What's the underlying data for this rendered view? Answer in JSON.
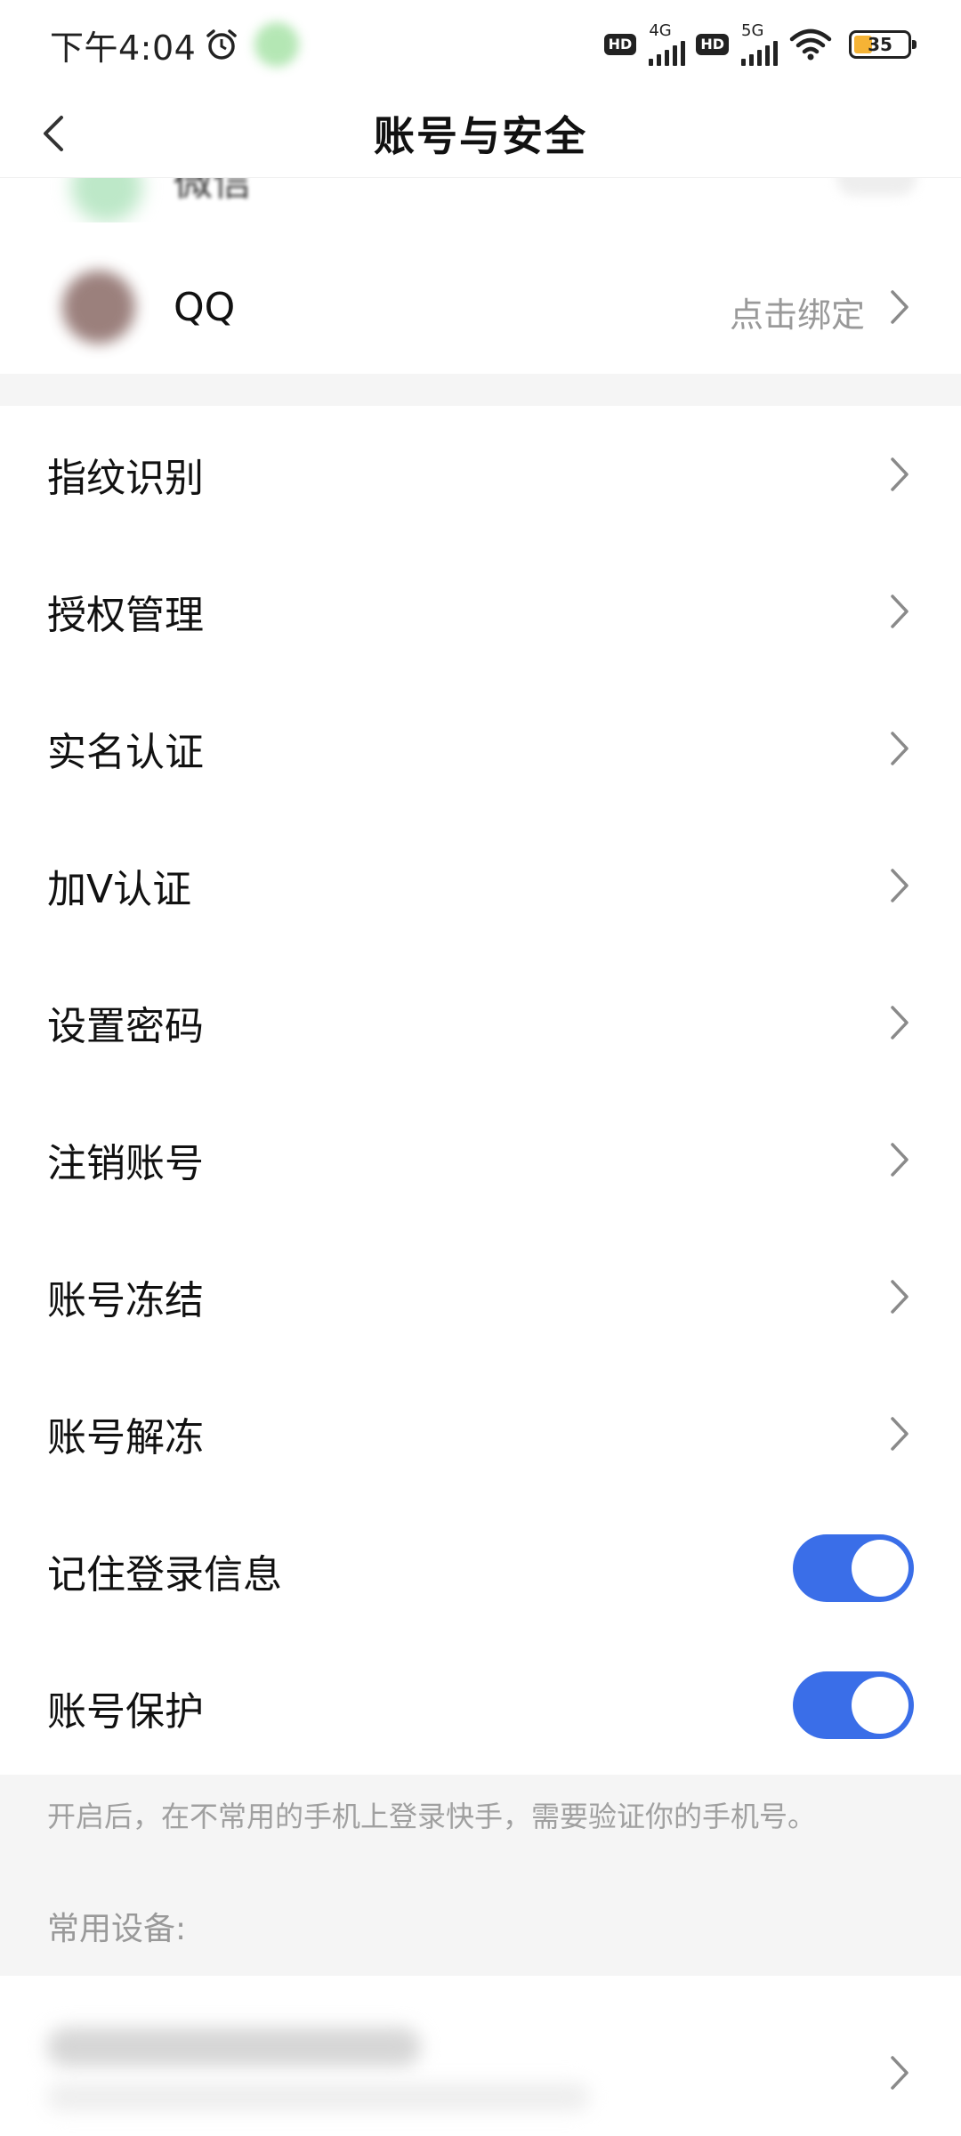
{
  "status_bar": {
    "time": "下午4:04",
    "hd_label": "HD",
    "net1": "4G",
    "net2": "5G",
    "battery": "35",
    "battery_level": 0.35
  },
  "nav": {
    "title": "账号与安全",
    "back_icon": "chevron-left-icon"
  },
  "bindings": {
    "partial_label": "微信",
    "qq_label": "QQ",
    "qq_action": "点击绑定"
  },
  "menu": {
    "items": [
      {
        "label": "指纹识别",
        "type": "link"
      },
      {
        "label": "授权管理",
        "type": "link"
      },
      {
        "label": "实名认证",
        "type": "link"
      },
      {
        "label": "加V认证",
        "type": "link"
      },
      {
        "label": "设置密码",
        "type": "link"
      },
      {
        "label": "注销账号",
        "type": "link"
      },
      {
        "label": "账号冻结",
        "type": "link"
      },
      {
        "label": "账号解冻",
        "type": "link"
      },
      {
        "label": "记住登录信息",
        "type": "toggle",
        "on": true
      },
      {
        "label": "账号保护",
        "type": "toggle",
        "on": true
      }
    ]
  },
  "footer": {
    "note": "开启后，在不常用的手机上登录快手，需要验证你的手机号。",
    "devices_label": "常用设备:"
  },
  "colors": {
    "toggle_on": "#3a6ee8",
    "section_bg": "#f5f5f5",
    "secondary_text": "#999999"
  }
}
